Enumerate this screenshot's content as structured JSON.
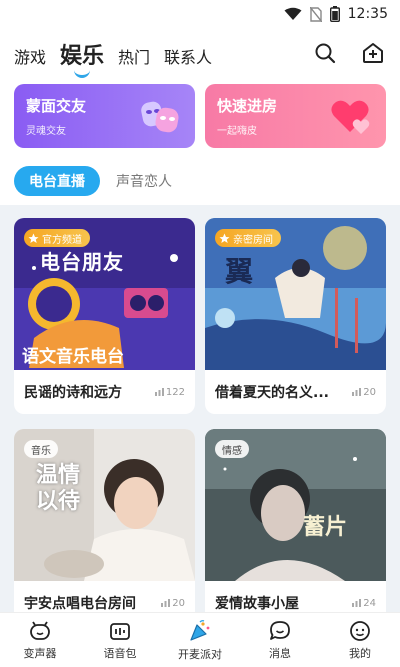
{
  "status_bar": {
    "time": "12:35"
  },
  "top_nav": {
    "tabs": [
      {
        "label": "游戏",
        "active": false
      },
      {
        "label": "娱乐",
        "active": true
      },
      {
        "label": "热门",
        "active": false
      },
      {
        "label": "联系人",
        "active": false
      }
    ],
    "actions": [
      "search-icon",
      "add-room-icon"
    ]
  },
  "banners": [
    {
      "title": "蒙面交友",
      "subtitle": "灵魂交友",
      "color": "#8a5cf3",
      "icon": "mask-icon"
    },
    {
      "title": "快速进房",
      "subtitle": "一起嗨皮",
      "color": "#f77aa6",
      "icon": "hearts-icon"
    }
  ],
  "sub_tabs": [
    {
      "label": "电台直播",
      "active": true
    },
    {
      "label": "声音恋人",
      "active": false
    }
  ],
  "cards": [
    {
      "badge": "官方频道",
      "badge_style": "gold",
      "poster_text": "电台朋友",
      "poster_caption": "语文音乐电台",
      "title": "民谣的诗和远方",
      "count": "122"
    },
    {
      "badge": "亲密房间",
      "badge_style": "gold",
      "poster_text": "翼",
      "poster_caption": "",
      "title": "借着夏天的名义...",
      "count": "20"
    },
    {
      "badge": "音乐",
      "badge_style": "plain",
      "poster_text": "温情以待",
      "poster_caption": "",
      "title": "宇安点唱电台房间",
      "count": "20"
    },
    {
      "badge": "情感",
      "badge_style": "plain",
      "poster_text": "蓄片",
      "poster_caption": "",
      "title": "爱情故事小屋",
      "count": "24"
    }
  ],
  "bottom_nav": [
    {
      "label": "变声器",
      "icon": "voice-changer-icon"
    },
    {
      "label": "语音包",
      "icon": "voice-pack-icon"
    },
    {
      "label": "开麦派对",
      "icon": "party-icon"
    },
    {
      "label": "消息",
      "icon": "message-icon"
    },
    {
      "label": "我的",
      "icon": "profile-icon"
    }
  ]
}
